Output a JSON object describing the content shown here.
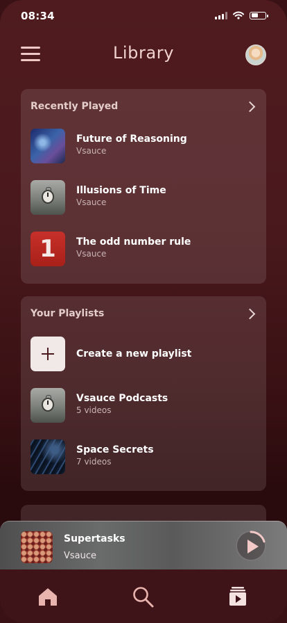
{
  "status": {
    "time": "08:34"
  },
  "header": {
    "title": "Library"
  },
  "recent": {
    "title": "Recently Played",
    "items": [
      {
        "title": "Future of Reasoning",
        "subtitle": "Vsauce",
        "thumb": "galaxy"
      },
      {
        "title": "Illusions of Time",
        "subtitle": "Vsauce",
        "thumb": "pocket-watch"
      },
      {
        "title": "The odd number rule",
        "subtitle": "Vsauce",
        "thumb": "number-one"
      }
    ]
  },
  "playlists": {
    "title": "Your Playlists",
    "create_label": "Create a new playlist",
    "items": [
      {
        "title": "Vsauce Podcasts",
        "subtitle": "5 videos",
        "thumb": "pocket-watch"
      },
      {
        "title": "Space Secrets",
        "subtitle": "7 videos",
        "thumb": "space"
      }
    ]
  },
  "player": {
    "title": "Supertasks",
    "subtitle": "Vsauce",
    "progress": 0.2
  },
  "tabs": [
    {
      "icon": "home-icon",
      "active": true
    },
    {
      "icon": "search-icon",
      "active": false
    },
    {
      "icon": "library-icon",
      "active": true
    }
  ],
  "colors": {
    "accent": "#f2c9c6",
    "background": "#4f1b1f"
  }
}
